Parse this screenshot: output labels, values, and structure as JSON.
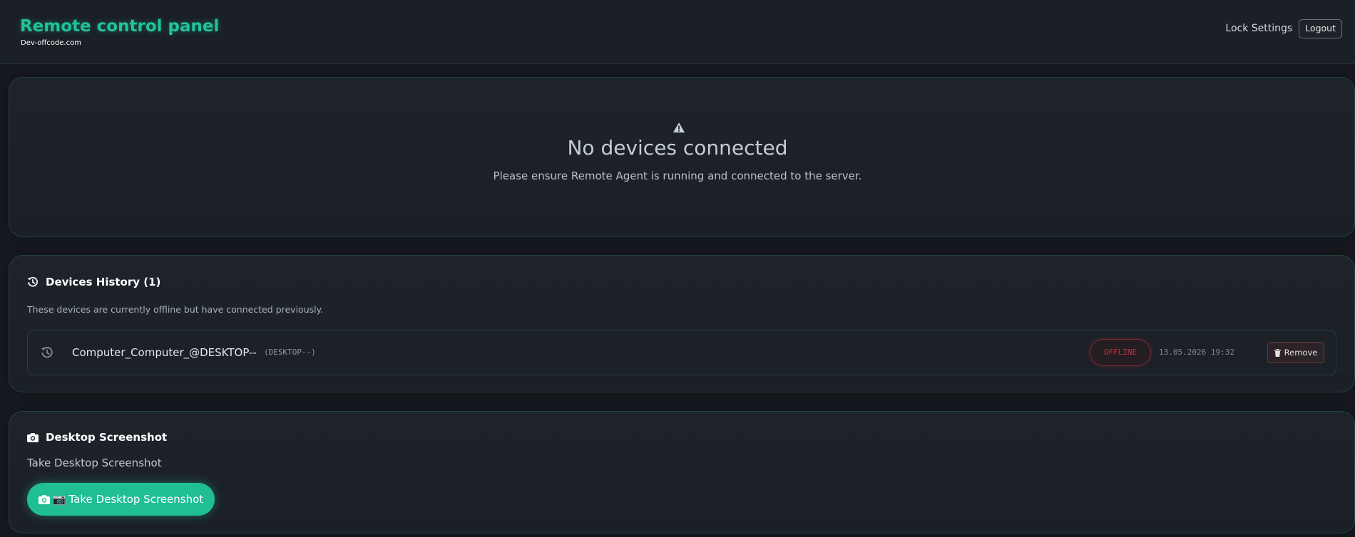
{
  "header": {
    "title": "Remote control panel",
    "subtitle": "Dev-offcode.com",
    "lock_settings_label": "Lock Settings",
    "logout_label": "Logout"
  },
  "empty_state": {
    "icon": "warning-icon",
    "title": "No devices connected",
    "description": "Please ensure Remote Agent is running and connected to the server."
  },
  "history": {
    "icon": "history-icon",
    "title": "Devices History (1)",
    "description": "These devices are currently offline but have connected previously.",
    "devices": [
      {
        "icon": "history-icon",
        "name": "Computer_Computer_@DESKTOP--",
        "host": "(DESKTOP--)",
        "status": "OFFLINE",
        "last_seen": "13.05.2026 19:32",
        "remove_label": "Remove",
        "remove_icon": "trash-icon"
      }
    ]
  },
  "screenshot": {
    "icon": "camera-icon",
    "title": "Desktop Screenshot",
    "description": "Take Desktop Screenshot",
    "button_emoji": "📷",
    "button_label": "Take Desktop Screenshot"
  },
  "colors": {
    "accent": "#22c39a",
    "button": "#1fbf93",
    "offline": "#c0343f",
    "background": "#161a20"
  }
}
